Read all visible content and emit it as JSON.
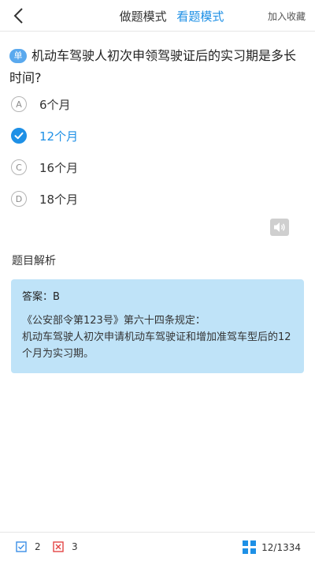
{
  "header": {
    "back_icon": "chevron-left-icon",
    "modes": [
      {
        "label": "做题模式",
        "active": false
      },
      {
        "label": "看题模式",
        "active": true
      }
    ],
    "favorite_label": "加入收藏"
  },
  "question": {
    "badge": "单",
    "text": "机动车驾驶人初次申领驾驶证后的实习期是多长时间?"
  },
  "options": [
    {
      "letter": "A",
      "text": "6个月",
      "selected": false
    },
    {
      "letter": "B",
      "text": "12个月",
      "selected": true
    },
    {
      "letter": "C",
      "text": "16个月",
      "selected": false
    },
    {
      "letter": "D",
      "text": "18个月",
      "selected": false
    }
  ],
  "audio_icon": "speaker-icon",
  "analysis": {
    "title": "题目解析",
    "answer": "答案：B",
    "source": "《公安部令第123号》第六十四条规定：",
    "explanation": "机动车驾驶人初次申请机动车驾驶证和增加准驾车型后的12个月为实习期。"
  },
  "footer": {
    "correct_count": "2",
    "wrong_count": "3",
    "progress": "12/1334",
    "correct_icon": "check-box-icon",
    "wrong_icon": "x-box-icon",
    "grid_icon": "grid-icon"
  },
  "colors": {
    "accent": "#1e90e6",
    "badge": "#5aa9ee",
    "analysis_bg": "#bfe3f8",
    "correct": "#3a8ee6",
    "wrong": "#e34545"
  }
}
